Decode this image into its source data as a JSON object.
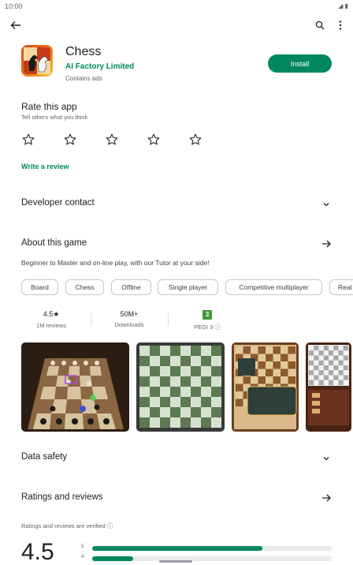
{
  "status": {
    "time": "10:00"
  },
  "app": {
    "name": "Chess",
    "developer": "AI Factory Limited",
    "ads": "Contains ads",
    "install_label": "Install"
  },
  "rate": {
    "title": "Rate this app",
    "subtitle": "Tell others what you think",
    "write_review": "Write a review"
  },
  "sections": {
    "developer_contact": "Developer contact",
    "about": "About this game",
    "data_safety": "Data safety",
    "ratings": "Ratings and reviews"
  },
  "about_desc": "Beginner to Master and on-line play, with our Tutor at your side!",
  "chips": [
    "Board",
    "Chess",
    "Offline",
    "Single player",
    "Competitive multiplayer",
    "Real"
  ],
  "stats": {
    "rating": "4.5★",
    "reviews": "1M reviews",
    "downloads_value": "50M+",
    "downloads_label": "Downloads",
    "pegi_badge": "3",
    "pegi_label": "PEGI 3 ⓘ"
  },
  "verified": "Ratings and reviews are verified ⓘ",
  "overall_rating": "4.5",
  "rating_bars": [
    {
      "stars": "5",
      "fraction": 0.71
    },
    {
      "stars": "4",
      "fraction": 0.17
    }
  ],
  "colors": {
    "accent": "#01875f"
  }
}
